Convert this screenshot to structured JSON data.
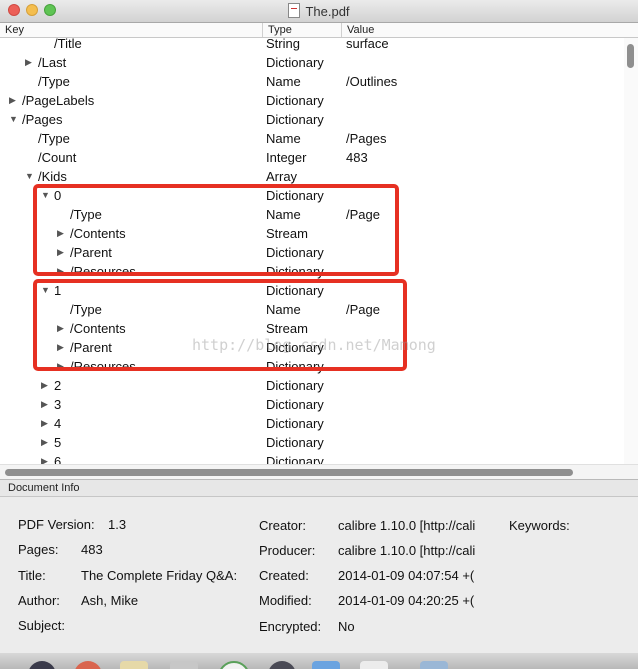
{
  "window": {
    "title": "The.pdf",
    "buttons": [
      "close",
      "minimize",
      "zoom"
    ]
  },
  "columns": {
    "key": "Key",
    "type": "Type",
    "value": "Value"
  },
  "tree_rows": [
    {
      "key": "/Title",
      "type": "String",
      "value": "surface",
      "level": 2,
      "toggle": "none"
    },
    {
      "key": "/Last",
      "type": "Dictionary",
      "value": "",
      "level": 1,
      "toggle": "collapsed"
    },
    {
      "key": "/Type",
      "type": "Name",
      "value": "/Outlines",
      "level": 1,
      "toggle": "none"
    },
    {
      "key": "/PageLabels",
      "type": "Dictionary",
      "value": "",
      "level": 0,
      "toggle": "collapsed"
    },
    {
      "key": "/Pages",
      "type": "Dictionary",
      "value": "",
      "level": 0,
      "toggle": "expanded"
    },
    {
      "key": "/Type",
      "type": "Name",
      "value": "/Pages",
      "level": 1,
      "toggle": "none"
    },
    {
      "key": "/Count",
      "type": "Integer",
      "value": "483",
      "level": 1,
      "toggle": "none"
    },
    {
      "key": "/Kids",
      "type": "Array",
      "value": "",
      "level": 1,
      "toggle": "expanded"
    },
    {
      "key": "0",
      "type": "Dictionary",
      "value": "",
      "level": 2,
      "toggle": "expanded"
    },
    {
      "key": "/Type",
      "type": "Name",
      "value": "/Page",
      "level": 3,
      "toggle": "none"
    },
    {
      "key": "/Contents",
      "type": "Stream",
      "value": "",
      "level": 3,
      "toggle": "collapsed"
    },
    {
      "key": "/Parent",
      "type": "Dictionary",
      "value": "",
      "level": 3,
      "toggle": "collapsed"
    },
    {
      "key": "/Resources",
      "type": "Dictionary",
      "value": "",
      "level": 3,
      "toggle": "collapsed"
    },
    {
      "key": "1",
      "type": "Dictionary",
      "value": "",
      "level": 2,
      "toggle": "expanded"
    },
    {
      "key": "/Type",
      "type": "Name",
      "value": "/Page",
      "level": 3,
      "toggle": "none"
    },
    {
      "key": "/Contents",
      "type": "Stream",
      "value": "",
      "level": 3,
      "toggle": "collapsed"
    },
    {
      "key": "/Parent",
      "type": "Dictionary",
      "value": "",
      "level": 3,
      "toggle": "collapsed"
    },
    {
      "key": "/Resources",
      "type": "Dictionary",
      "value": "",
      "level": 3,
      "toggle": "collapsed"
    },
    {
      "key": "2",
      "type": "Dictionary",
      "value": "",
      "level": 2,
      "toggle": "collapsed"
    },
    {
      "key": "3",
      "type": "Dictionary",
      "value": "",
      "level": 2,
      "toggle": "collapsed"
    },
    {
      "key": "4",
      "type": "Dictionary",
      "value": "",
      "level": 2,
      "toggle": "collapsed"
    },
    {
      "key": "5",
      "type": "Dictionary",
      "value": "",
      "level": 2,
      "toggle": "collapsed"
    },
    {
      "key": "6",
      "type": "Dictionary",
      "value": "",
      "level": 2,
      "toggle": "collapsed"
    }
  ],
  "document_info": {
    "header": "Document Info",
    "fields": [
      {
        "label": "PDF Version:",
        "value": "1.3"
      },
      {
        "label": "Pages:",
        "value": "483"
      },
      {
        "label": "Title:",
        "value": "The Complete Friday Q&A:"
      },
      {
        "label": "Author:",
        "value": "Ash, Mike"
      },
      {
        "label": "Subject:",
        "value": ""
      },
      {
        "label": "Creator:",
        "value": "calibre 1.10.0 [http://cali"
      },
      {
        "label": "Producer:",
        "value": "calibre 1.10.0 [http://cali"
      },
      {
        "label": "Created:",
        "value": "2014-01-09 04:07:54 +("
      },
      {
        "label": "Modified:",
        "value": "2014-01-09 04:20:25 +("
      },
      {
        "label": "Encrypted:",
        "value": "No"
      },
      {
        "label": "Keywords:",
        "value": ""
      }
    ]
  },
  "watermark": "http://blog.csdn.net/Mamong",
  "colors": {
    "highlight_box": "#e63022",
    "background": "#ececec"
  }
}
